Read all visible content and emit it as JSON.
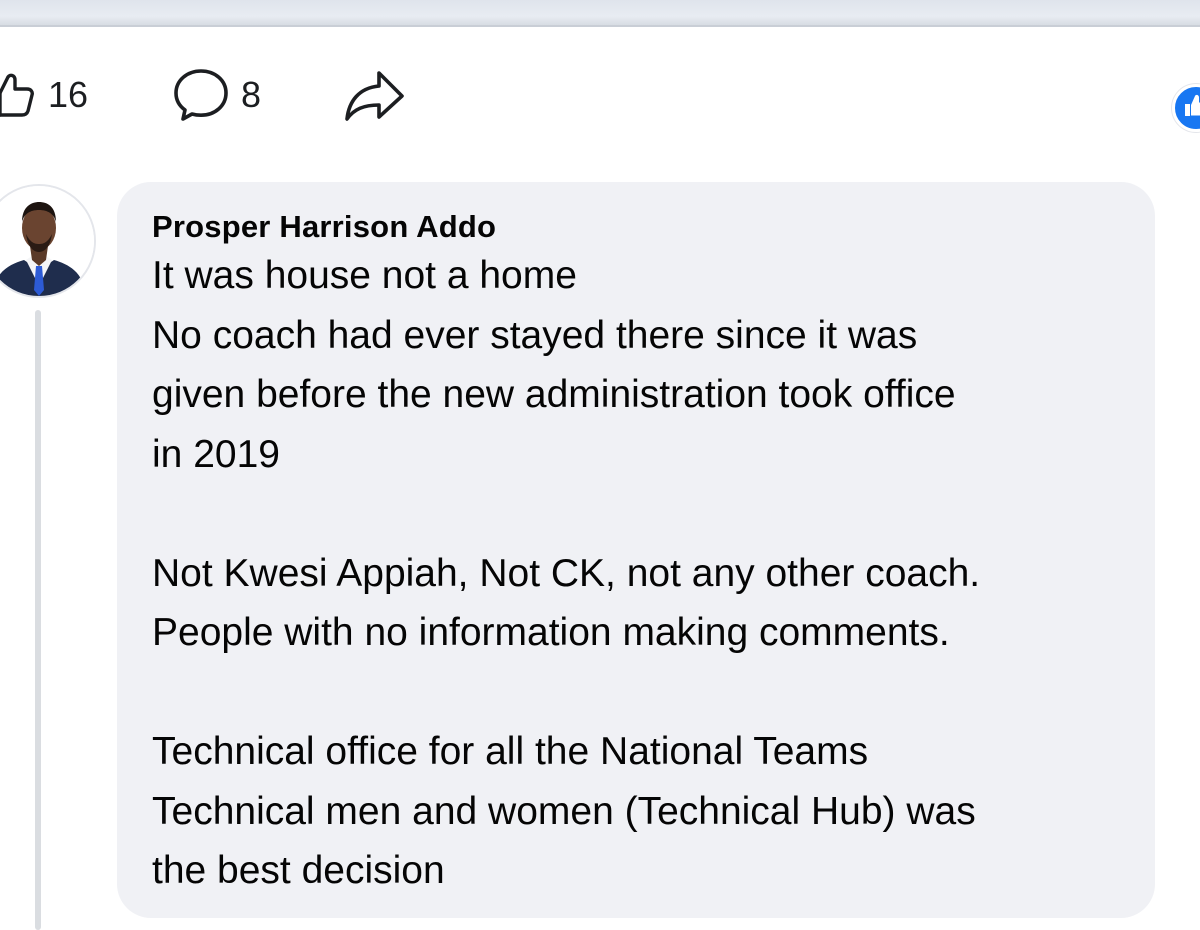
{
  "post_actions": {
    "like_count": "16",
    "comment_count": "8"
  },
  "comment": {
    "author": "Prosper Harrison Addo",
    "paragraphs": [
      {
        "lines": [
          "It was house not a home",
          "No coach had ever stayed there since it was",
          "given before the new administration took office",
          "in 2019"
        ]
      },
      {
        "lines": [
          "Not Kwesi Appiah, Not CK, not any other coach.",
          "People with no information making comments."
        ]
      },
      {
        "lines": [
          "Technical office for all the National Teams",
          "Technical men and women (Technical Hub) was",
          "the best decision"
        ]
      }
    ]
  },
  "icons": {
    "like": "thumbs-up-icon",
    "comment": "comment-bubble-icon",
    "share": "share-arrow-icon",
    "reaction": "like-reaction-icon"
  },
  "colors": {
    "bubble_background": "#f0f1f5",
    "reaction_blue": "#1877f2",
    "text": "#050505",
    "thread_line": "#dadde1"
  }
}
